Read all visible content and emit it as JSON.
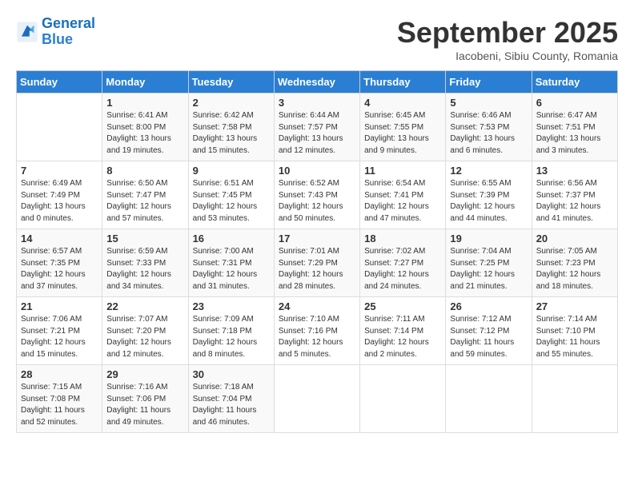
{
  "logo": {
    "line1": "General",
    "line2": "Blue"
  },
  "title": "September 2025",
  "subtitle": "Iacobeni, Sibiu County, Romania",
  "days_of_week": [
    "Sunday",
    "Monday",
    "Tuesday",
    "Wednesday",
    "Thursday",
    "Friday",
    "Saturday"
  ],
  "weeks": [
    [
      {
        "day": "",
        "info": ""
      },
      {
        "day": "1",
        "info": "Sunrise: 6:41 AM\nSunset: 8:00 PM\nDaylight: 13 hours\nand 19 minutes."
      },
      {
        "day": "2",
        "info": "Sunrise: 6:42 AM\nSunset: 7:58 PM\nDaylight: 13 hours\nand 15 minutes."
      },
      {
        "day": "3",
        "info": "Sunrise: 6:44 AM\nSunset: 7:57 PM\nDaylight: 13 hours\nand 12 minutes."
      },
      {
        "day": "4",
        "info": "Sunrise: 6:45 AM\nSunset: 7:55 PM\nDaylight: 13 hours\nand 9 minutes."
      },
      {
        "day": "5",
        "info": "Sunrise: 6:46 AM\nSunset: 7:53 PM\nDaylight: 13 hours\nand 6 minutes."
      },
      {
        "day": "6",
        "info": "Sunrise: 6:47 AM\nSunset: 7:51 PM\nDaylight: 13 hours\nand 3 minutes."
      }
    ],
    [
      {
        "day": "7",
        "info": "Sunrise: 6:49 AM\nSunset: 7:49 PM\nDaylight: 13 hours\nand 0 minutes."
      },
      {
        "day": "8",
        "info": "Sunrise: 6:50 AM\nSunset: 7:47 PM\nDaylight: 12 hours\nand 57 minutes."
      },
      {
        "day": "9",
        "info": "Sunrise: 6:51 AM\nSunset: 7:45 PM\nDaylight: 12 hours\nand 53 minutes."
      },
      {
        "day": "10",
        "info": "Sunrise: 6:52 AM\nSunset: 7:43 PM\nDaylight: 12 hours\nand 50 minutes."
      },
      {
        "day": "11",
        "info": "Sunrise: 6:54 AM\nSunset: 7:41 PM\nDaylight: 12 hours\nand 47 minutes."
      },
      {
        "day": "12",
        "info": "Sunrise: 6:55 AM\nSunset: 7:39 PM\nDaylight: 12 hours\nand 44 minutes."
      },
      {
        "day": "13",
        "info": "Sunrise: 6:56 AM\nSunset: 7:37 PM\nDaylight: 12 hours\nand 41 minutes."
      }
    ],
    [
      {
        "day": "14",
        "info": "Sunrise: 6:57 AM\nSunset: 7:35 PM\nDaylight: 12 hours\nand 37 minutes."
      },
      {
        "day": "15",
        "info": "Sunrise: 6:59 AM\nSunset: 7:33 PM\nDaylight: 12 hours\nand 34 minutes."
      },
      {
        "day": "16",
        "info": "Sunrise: 7:00 AM\nSunset: 7:31 PM\nDaylight: 12 hours\nand 31 minutes."
      },
      {
        "day": "17",
        "info": "Sunrise: 7:01 AM\nSunset: 7:29 PM\nDaylight: 12 hours\nand 28 minutes."
      },
      {
        "day": "18",
        "info": "Sunrise: 7:02 AM\nSunset: 7:27 PM\nDaylight: 12 hours\nand 24 minutes."
      },
      {
        "day": "19",
        "info": "Sunrise: 7:04 AM\nSunset: 7:25 PM\nDaylight: 12 hours\nand 21 minutes."
      },
      {
        "day": "20",
        "info": "Sunrise: 7:05 AM\nSunset: 7:23 PM\nDaylight: 12 hours\nand 18 minutes."
      }
    ],
    [
      {
        "day": "21",
        "info": "Sunrise: 7:06 AM\nSunset: 7:21 PM\nDaylight: 12 hours\nand 15 minutes."
      },
      {
        "day": "22",
        "info": "Sunrise: 7:07 AM\nSunset: 7:20 PM\nDaylight: 12 hours\nand 12 minutes."
      },
      {
        "day": "23",
        "info": "Sunrise: 7:09 AM\nSunset: 7:18 PM\nDaylight: 12 hours\nand 8 minutes."
      },
      {
        "day": "24",
        "info": "Sunrise: 7:10 AM\nSunset: 7:16 PM\nDaylight: 12 hours\nand 5 minutes."
      },
      {
        "day": "25",
        "info": "Sunrise: 7:11 AM\nSunset: 7:14 PM\nDaylight: 12 hours\nand 2 minutes."
      },
      {
        "day": "26",
        "info": "Sunrise: 7:12 AM\nSunset: 7:12 PM\nDaylight: 11 hours\nand 59 minutes."
      },
      {
        "day": "27",
        "info": "Sunrise: 7:14 AM\nSunset: 7:10 PM\nDaylight: 11 hours\nand 55 minutes."
      }
    ],
    [
      {
        "day": "28",
        "info": "Sunrise: 7:15 AM\nSunset: 7:08 PM\nDaylight: 11 hours\nand 52 minutes."
      },
      {
        "day": "29",
        "info": "Sunrise: 7:16 AM\nSunset: 7:06 PM\nDaylight: 11 hours\nand 49 minutes."
      },
      {
        "day": "30",
        "info": "Sunrise: 7:18 AM\nSunset: 7:04 PM\nDaylight: 11 hours\nand 46 minutes."
      },
      {
        "day": "",
        "info": ""
      },
      {
        "day": "",
        "info": ""
      },
      {
        "day": "",
        "info": ""
      },
      {
        "day": "",
        "info": ""
      }
    ]
  ]
}
